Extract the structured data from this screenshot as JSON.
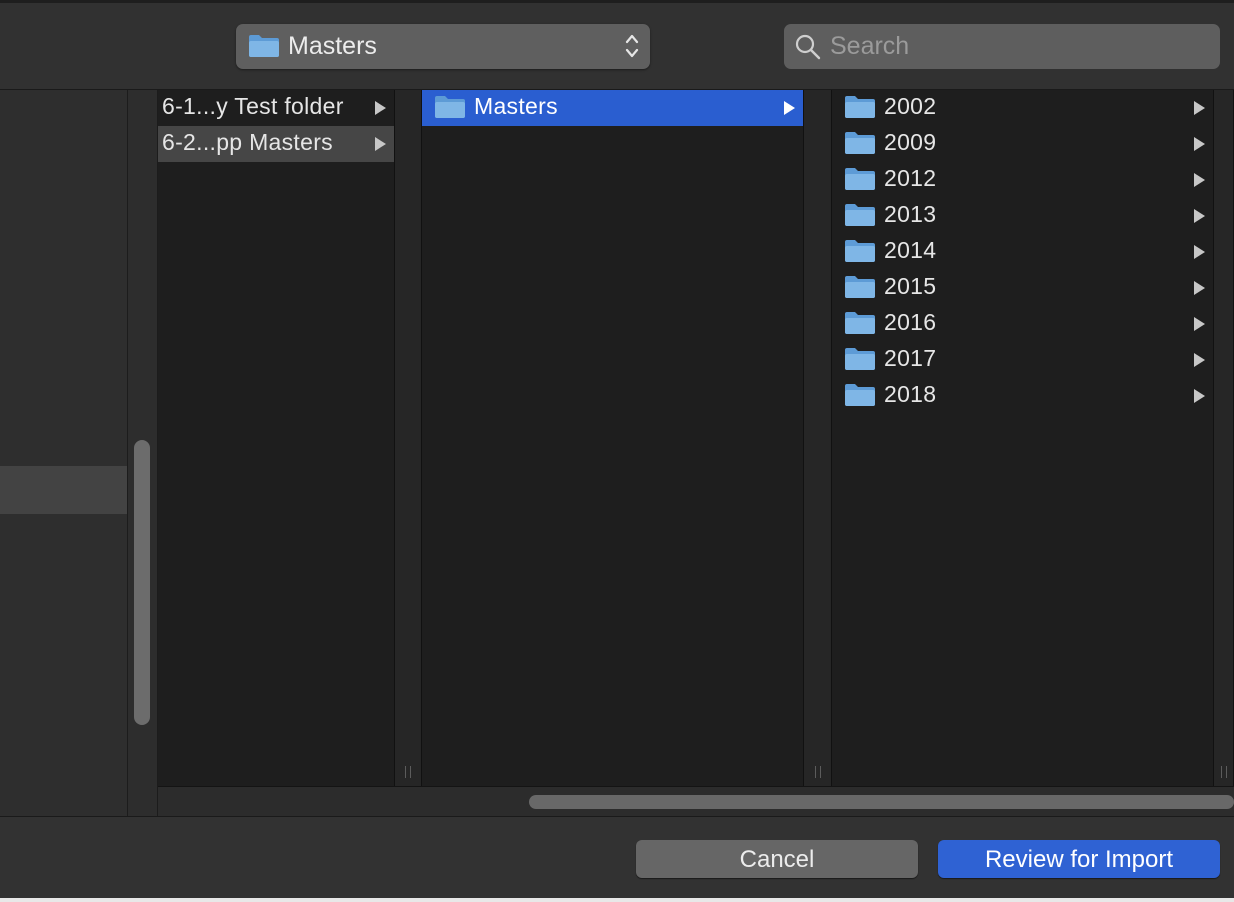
{
  "toolbar": {
    "path_popup": {
      "label": "Masters",
      "icon": "folder-icon"
    },
    "search": {
      "placeholder": "Search",
      "value": "",
      "icon": "magnifier-icon"
    }
  },
  "columns": [
    {
      "items": [
        {
          "label": "6-1...y Test folder",
          "selected": "none",
          "has_children": true
        },
        {
          "label": "6-2...pp Masters",
          "selected": "inactive",
          "has_children": true
        }
      ]
    },
    {
      "items": [
        {
          "label": "Masters",
          "selected": "active",
          "has_children": true,
          "icon": "folder-icon"
        }
      ]
    },
    {
      "items": [
        {
          "label": "2002",
          "icon": "folder-icon",
          "has_children": true
        },
        {
          "label": "2009",
          "icon": "folder-icon",
          "has_children": true
        },
        {
          "label": "2012",
          "icon": "folder-icon",
          "has_children": true
        },
        {
          "label": "2013",
          "icon": "folder-icon",
          "has_children": true
        },
        {
          "label": "2014",
          "icon": "folder-icon",
          "has_children": true
        },
        {
          "label": "2015",
          "icon": "folder-icon",
          "has_children": true
        },
        {
          "label": "2016",
          "icon": "folder-icon",
          "has_children": true
        },
        {
          "label": "2017",
          "icon": "folder-icon",
          "has_children": true
        },
        {
          "label": "2018",
          "icon": "folder-icon",
          "has_children": true
        }
      ]
    }
  ],
  "footer": {
    "cancel_label": "Cancel",
    "primary_label": "Review for Import"
  },
  "colors": {
    "selection_blue": "#2a5ed0",
    "primary_button": "#2f62d3",
    "folder_blue": "#7fb6e6"
  }
}
